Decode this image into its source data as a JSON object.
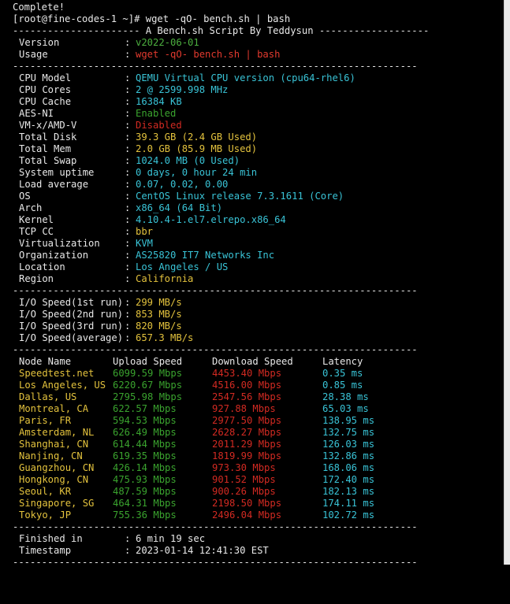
{
  "colors": {
    "background": "#000000",
    "text": "#e8e8e8",
    "green": "#4caf3f",
    "red": "#e23a2e",
    "yellow": "#e3c23d",
    "cyan": "#39c3d6",
    "scrollbar": "#e9e9e9"
  },
  "prompt": {
    "complete": "Complete!",
    "command_line": "[root@fine-codes-1 ~]# wget -qO- bench.sh | bash"
  },
  "banner": "---------------------- A Bench.sh Script By Teddysun -------------------",
  "separator": "----------------------------------------------------------------------",
  "header": {
    "version_label": "Version",
    "version_value": "v2022-06-01",
    "usage_label": "Usage",
    "usage_value": "wget -qO- bench.sh | bash"
  },
  "system": [
    {
      "label": "CPU Model",
      "value": "QEMU Virtual CPU version (cpu64-rhel6)",
      "color": "cy"
    },
    {
      "label": "CPU Cores",
      "value": "2 @ 2599.998 MHz",
      "color": "cy"
    },
    {
      "label": "CPU Cache",
      "value": "16384 KB",
      "color": "cy"
    },
    {
      "label": "AES-NI",
      "value": "Enabled",
      "color": "gg"
    },
    {
      "label": "VM-x/AMD-V",
      "value": "Disabled",
      "color": "rr"
    },
    {
      "label": "Total Disk",
      "value": "39.3 GB (2.4 GB Used)",
      "color": "y"
    },
    {
      "label": "Total Mem",
      "value": "2.0 GB (85.9 MB Used)",
      "color": "y"
    },
    {
      "label": "Total Swap",
      "value": "1024.0 MB (0 Used)",
      "color": "cy"
    },
    {
      "label": "System uptime",
      "value": "0 days, 0 hour 24 min",
      "color": "cy"
    },
    {
      "label": "Load average",
      "value": "0.07, 0.02, 0.00",
      "color": "cy"
    },
    {
      "label": "OS",
      "value": "CentOS Linux release 7.3.1611 (Core)",
      "color": "cy"
    },
    {
      "label": "Arch",
      "value": "x86_64 (64 Bit)",
      "color": "cy"
    },
    {
      "label": "Kernel",
      "value": "4.10.4-1.el7.elrepo.x86_64",
      "color": "cy"
    },
    {
      "label": "TCP CC",
      "value": "bbr",
      "color": "y"
    },
    {
      "label": "Virtualization",
      "value": "KVM",
      "color": "cy"
    },
    {
      "label": "Organization",
      "value": "AS25820 IT7 Networks Inc",
      "color": "cy"
    },
    {
      "label": "Location",
      "value": "Los Angeles / US",
      "color": "cy"
    },
    {
      "label": "Region",
      "value": "California",
      "color": "y"
    }
  ],
  "io": [
    {
      "label": "I/O Speed(1st run)",
      "value": "299 MB/s"
    },
    {
      "label": "I/O Speed(2nd run)",
      "value": "853 MB/s"
    },
    {
      "label": "I/O Speed(3rd run)",
      "value": "820 MB/s"
    },
    {
      "label": "I/O Speed(average)",
      "value": "657.3 MB/s"
    }
  ],
  "speed_headers": {
    "node": "Node Name",
    "upload": "Upload Speed",
    "download": "Download Speed",
    "latency": "Latency"
  },
  "speed_rows": [
    {
      "node": "Speedtest.net",
      "upload": "6099.59 Mbps",
      "download": "4453.40 Mbps",
      "latency": "0.35 ms"
    },
    {
      "node": "Los Angeles, US",
      "upload": "6220.67 Mbps",
      "download": "4516.00 Mbps",
      "latency": "0.85 ms"
    },
    {
      "node": "Dallas, US",
      "upload": "2795.98 Mbps",
      "download": "2547.56 Mbps",
      "latency": "28.38 ms"
    },
    {
      "node": "Montreal, CA",
      "upload": "622.57 Mbps",
      "download": "927.88 Mbps",
      "latency": "65.03 ms"
    },
    {
      "node": "Paris, FR",
      "upload": "594.53 Mbps",
      "download": "2977.50 Mbps",
      "latency": "138.95 ms"
    },
    {
      "node": "Amsterdam, NL",
      "upload": "626.49 Mbps",
      "download": "2628.27 Mbps",
      "latency": "132.75 ms"
    },
    {
      "node": "Shanghai, CN",
      "upload": "614.44 Mbps",
      "download": "2011.29 Mbps",
      "latency": "126.03 ms"
    },
    {
      "node": "Nanjing, CN",
      "upload": "619.35 Mbps",
      "download": "1819.99 Mbps",
      "latency": "132.86 ms"
    },
    {
      "node": "Guangzhou, CN",
      "upload": "426.14 Mbps",
      "download": "973.30 Mbps",
      "latency": "168.06 ms"
    },
    {
      "node": "Hongkong, CN",
      "upload": "475.93 Mbps",
      "download": "901.52 Mbps",
      "latency": "172.40 ms"
    },
    {
      "node": "Seoul, KR",
      "upload": "487.59 Mbps",
      "download": "900.26 Mbps",
      "latency": "182.13 ms"
    },
    {
      "node": "Singapore, SG",
      "upload": "464.31 Mbps",
      "download": "2198.50 Mbps",
      "latency": "174.11 ms"
    },
    {
      "node": "Tokyo, JP",
      "upload": "755.36 Mbps",
      "download": "2496.04 Mbps",
      "latency": "102.72 ms"
    }
  ],
  "footer": {
    "finished_label": "Finished in",
    "finished_value": "6 min 19 sec",
    "timestamp_label": "Timestamp",
    "timestamp_value": "2023-01-14 12:41:30 EST"
  }
}
